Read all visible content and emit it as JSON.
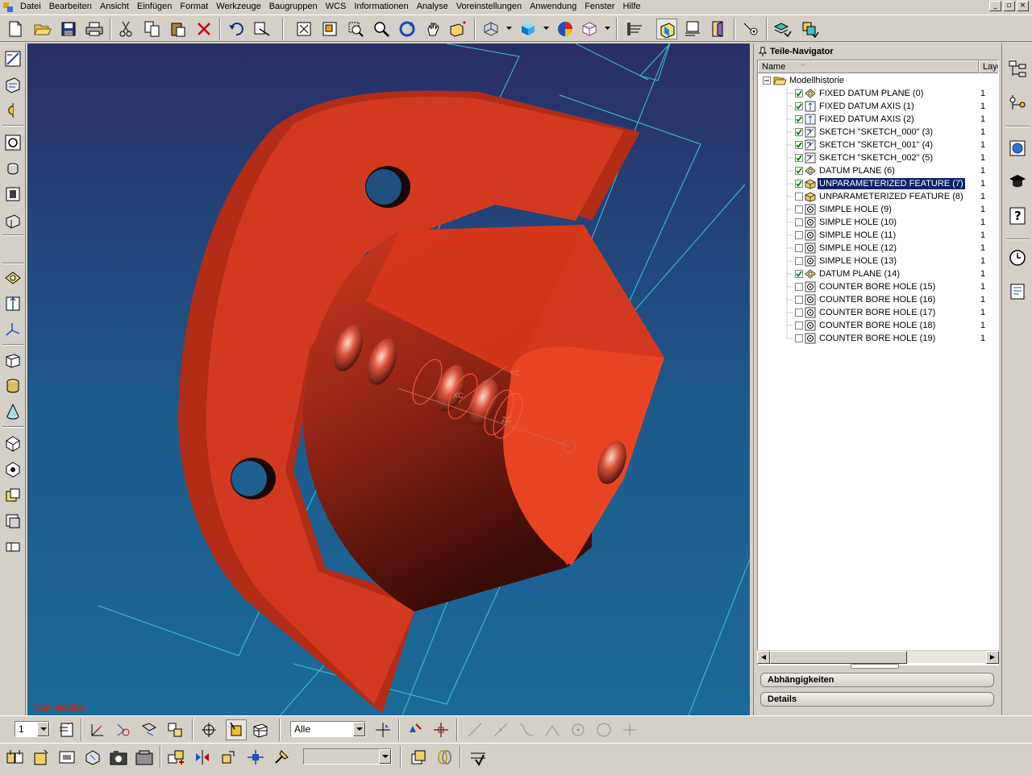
{
  "menu": [
    "Datei",
    "Bearbeiten",
    "Ansicht",
    "Einfügen",
    "Format",
    "Werkzeuge",
    "Baugruppen",
    "WCS",
    "Informationen",
    "Analyse",
    "Voreinstellungen",
    "Anwendung",
    "Fenster",
    "Hilfe"
  ],
  "window_controls": [
    "_",
    "▫",
    "×"
  ],
  "viewport": {
    "view_label": "TOP WORK",
    "axis_labels": [
      "YC",
      "XC",
      "ZC"
    ],
    "colors": {
      "part": "#d23a20",
      "background_top": "#2a2e66",
      "background_bottom": "#1b6a98",
      "datum": "#3fc7c7"
    }
  },
  "navigator": {
    "title": "Teile-Navigator",
    "columns": {
      "name": "Name",
      "layer": "Laye"
    },
    "root": "Modellhistorie",
    "features": [
      {
        "label": "FIXED DATUM PLANE (0)",
        "layer": "1",
        "checked": true,
        "icon": "datum-plane-icon"
      },
      {
        "label": "FIXED DATUM AXIS (1)",
        "layer": "1",
        "checked": true,
        "icon": "datum-axis-icon"
      },
      {
        "label": "FIXED DATUM AXIS (2)",
        "layer": "1",
        "checked": true,
        "icon": "datum-axis-icon"
      },
      {
        "label": "SKETCH \"SKETCH_000\" (3)",
        "layer": "1",
        "checked": true,
        "icon": "sketch-icon"
      },
      {
        "label": "SKETCH \"SKETCH_001\" (4)",
        "layer": "1",
        "checked": true,
        "icon": "sketch-icon"
      },
      {
        "label": "SKETCH \"SKETCH_002\" (5)",
        "layer": "1",
        "checked": true,
        "icon": "sketch-icon"
      },
      {
        "label": "DATUM PLANE (6)",
        "layer": "1",
        "checked": true,
        "icon": "datum-plane-icon"
      },
      {
        "label": "UNPARAMETERIZED FEATURE (7)",
        "layer": "1",
        "checked": true,
        "icon": "unparameterized-feature-icon",
        "selected": true
      },
      {
        "label": "UNPARAMETERIZED FEATURE (8)",
        "layer": "1",
        "checked": false,
        "icon": "unparameterized-feature-icon"
      },
      {
        "label": "SIMPLE HOLE (9)",
        "layer": "1",
        "checked": false,
        "icon": "hole-icon"
      },
      {
        "label": "SIMPLE HOLE (10)",
        "layer": "1",
        "checked": false,
        "icon": "hole-icon"
      },
      {
        "label": "SIMPLE HOLE (11)",
        "layer": "1",
        "checked": false,
        "icon": "hole-icon"
      },
      {
        "label": "SIMPLE HOLE (12)",
        "layer": "1",
        "checked": false,
        "icon": "hole-icon"
      },
      {
        "label": "SIMPLE HOLE (13)",
        "layer": "1",
        "checked": false,
        "icon": "hole-icon"
      },
      {
        "label": "DATUM PLANE (14)",
        "layer": "1",
        "checked": true,
        "icon": "datum-plane-icon"
      },
      {
        "label": "COUNTER BORE HOLE (15)",
        "layer": "1",
        "checked": false,
        "icon": "hole-icon"
      },
      {
        "label": "COUNTER BORE HOLE (16)",
        "layer": "1",
        "checked": false,
        "icon": "hole-icon"
      },
      {
        "label": "COUNTER BORE HOLE (17)",
        "layer": "1",
        "checked": false,
        "icon": "hole-icon"
      },
      {
        "label": "COUNTER BORE HOLE (18)",
        "layer": "1",
        "checked": false,
        "icon": "hole-icon"
      },
      {
        "label": "COUNTER BORE HOLE (19)",
        "layer": "1",
        "checked": false,
        "icon": "hole-icon"
      }
    ],
    "panels": {
      "dependencies": "Abhängigkeiten",
      "details": "Details"
    },
    "selection_color": "#0a246a"
  },
  "bottom": {
    "layer_value": "1",
    "filter_value": "Alle",
    "combo3_value": ""
  }
}
